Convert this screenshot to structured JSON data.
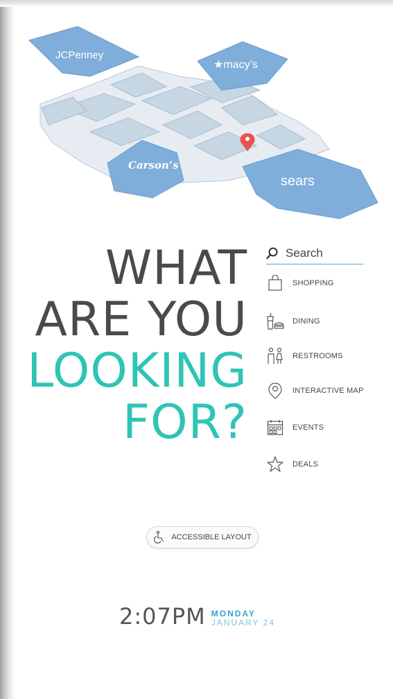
{
  "map": {
    "anchors": {
      "jcpenney": "JCPenney",
      "macys": "★macy’s",
      "carsons": "Carson’s",
      "sears": "sears"
    },
    "pin_icon": "location-pin-icon",
    "colors": {
      "anchor": "#7faedb",
      "store": "#c7d6e3",
      "corridor": "#e6ecf1",
      "pin": "#e9514f"
    }
  },
  "headline": {
    "line1": "WHAT",
    "line2": "ARE YOU",
    "line3": "LOOKING",
    "line4": "FOR?",
    "colors": {
      "dark": "#4a4a4a",
      "accent": "#2ec4b6"
    }
  },
  "search": {
    "label": "Search",
    "icon": "search-icon"
  },
  "menu": {
    "items": [
      {
        "label": "SHOPPING",
        "icon": "shopping-bag-icon"
      },
      {
        "label": "DINING",
        "icon": "dining-icon"
      },
      {
        "label": "RESTROOMS",
        "icon": "restroom-icon"
      },
      {
        "label": "INTERACTIVE MAP",
        "icon": "map-pin-icon"
      },
      {
        "label": "EVENTS",
        "icon": "calendar-icon"
      },
      {
        "label": "DEALS",
        "icon": "star-icon"
      }
    ]
  },
  "accessible": {
    "label": "ACCESSIBLE LAYOUT",
    "icon": "wheelchair-icon"
  },
  "clock": {
    "time": "2:07PM",
    "day": "MONDAY",
    "date": "JANUARY 24"
  }
}
